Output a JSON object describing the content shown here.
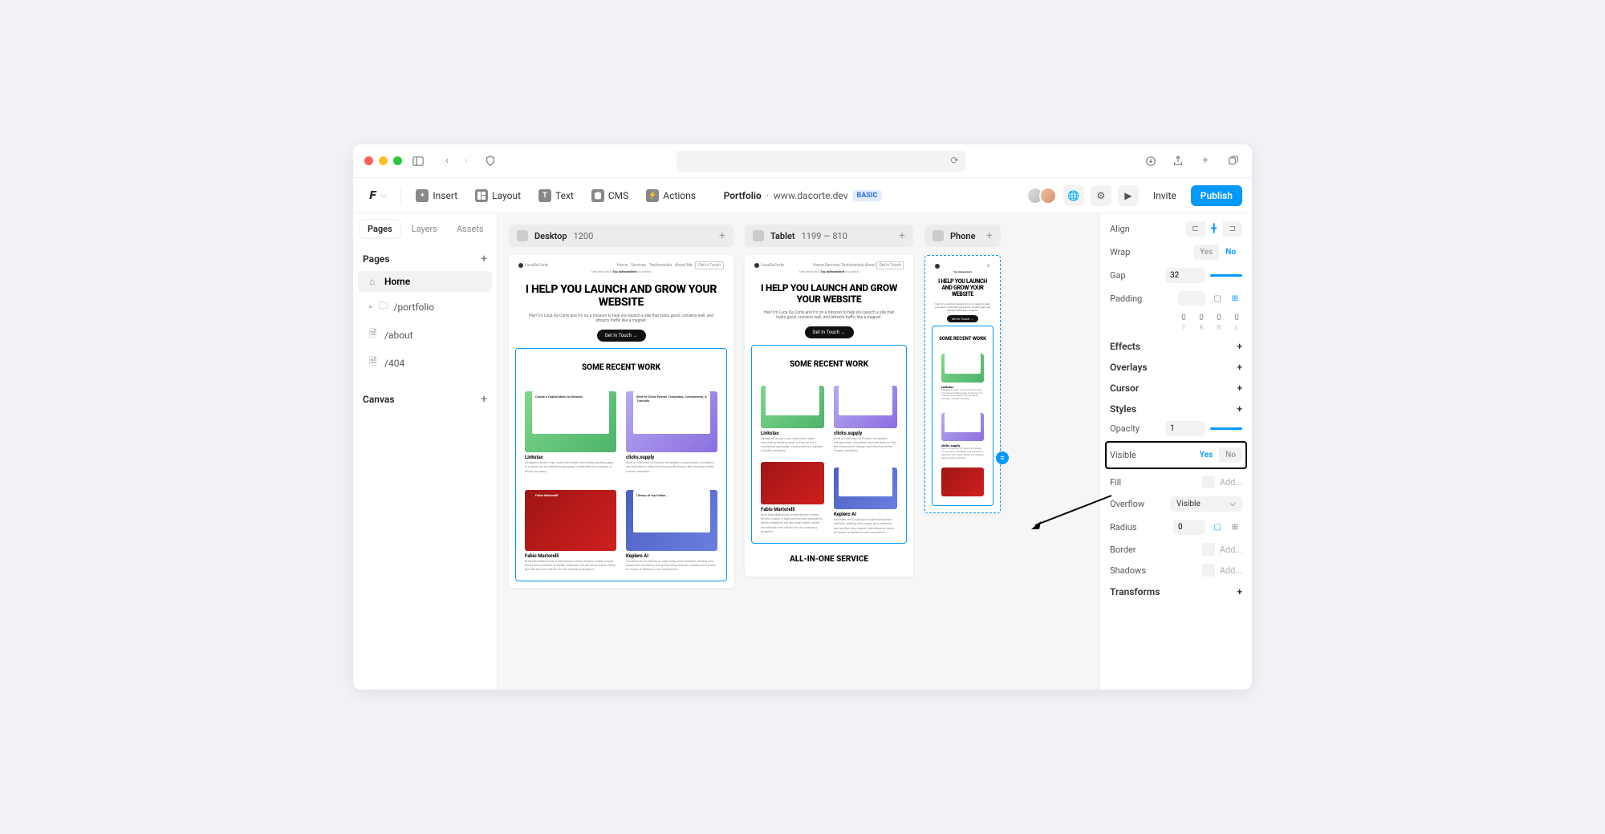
{
  "browser": {
    "shield_icon": "shield"
  },
  "toolbar": {
    "insert": "Insert",
    "layout": "Layout",
    "text": "Text",
    "cms": "CMS",
    "actions": "Actions",
    "title_bold": "Portfolio",
    "title_url": "www.dacorte.dev",
    "badge": "BASIC",
    "invite": "Invite",
    "publish": "Publish"
  },
  "sidebar": {
    "tabs": {
      "pages": "Pages",
      "layers": "Layers",
      "assets": "Assets"
    },
    "section_pages": "Pages",
    "items": [
      {
        "label": "Home",
        "active": true,
        "icon": "home"
      },
      {
        "label": "/portfolio",
        "active": false,
        "icon": "folder",
        "expandable": true
      },
      {
        "label": "/about",
        "active": false,
        "icon": "page"
      },
      {
        "label": "/404",
        "active": false,
        "icon": "page"
      }
    ],
    "section_canvas": "Canvas"
  },
  "breakpoints": [
    {
      "name": "Desktop",
      "size": "1200"
    },
    {
      "name": "Tablet",
      "size": "1199 — 810"
    },
    {
      "name": "Phone",
      "size": ""
    }
  ],
  "mock": {
    "tagline_pre": "Get Hired as a ",
    "tagline_bold": "Top Independent",
    "tagline_post": " on contra",
    "hero": "I HELP YOU LAUNCH AND GROW YOUR WEBSITE",
    "sub": "Hey! I'm Luca Da Corte and I'm on a mission to help you launch a site that looks good, converts well, and attracts traffic like a magnet.",
    "cta": "Get In Touch →",
    "recent": "SOME RECENT WORK",
    "allinone": "ALL-IN-ONE SERVICE",
    "cards": [
      {
        "title": "Linkstac",
        "desc": "Designed, wrote copy, and built a high-converting landing page in Framer for a marketing campaign conducted by Linkstac, a SAAS company."
      },
      {
        "title": "clicks.supply",
        "desc": "Built a collection of Framer templates, components, clonables, and tutorials to help the community design and develop better Framer websites."
      },
      {
        "title": "Fabio Martorelli",
        "desc": "Built FabioMartorelli, a well-known online fitness coach, a high-performing website to better establish his personal brand online and attract new clients for his coaching program."
      },
      {
        "title": "Keplero AI",
        "desc": "Assisted an AI startup in optimizing their website: adding new pages and sections, and performing regular maintenance tasks to ensure a flawless user experience."
      }
    ],
    "thumb_texts": {
      "green": "Create a Digital Menu in Minutes",
      "purple": "Best-In-Class Framer Templates, Components, & Tutorials.",
      "red": "Fabio Martorelli",
      "blue": "Library of top Italian…"
    }
  },
  "inspector": {
    "align": "Align",
    "wrap": "Wrap",
    "wrap_yes": "Yes",
    "wrap_no": "No",
    "gap": "Gap",
    "gap_val": "32",
    "padding": "Padding",
    "pad_vals": [
      "0",
      "0",
      "0",
      "0"
    ],
    "pad_labels": [
      "T",
      "R",
      "B",
      "L"
    ],
    "effects": "Effects",
    "overlays": "Overlays",
    "cursor": "Cursor",
    "styles": "Styles",
    "opacity": "Opacity",
    "opacity_val": "1",
    "visible": "Visible",
    "vis_yes": "Yes",
    "vis_no": "No",
    "fill": "Fill",
    "add": "Add...",
    "overflow": "Overflow",
    "overflow_val": "Visible",
    "radius": "Radius",
    "radius_val": "0",
    "border": "Border",
    "shadows": "Shadows",
    "transforms": "Transforms"
  }
}
